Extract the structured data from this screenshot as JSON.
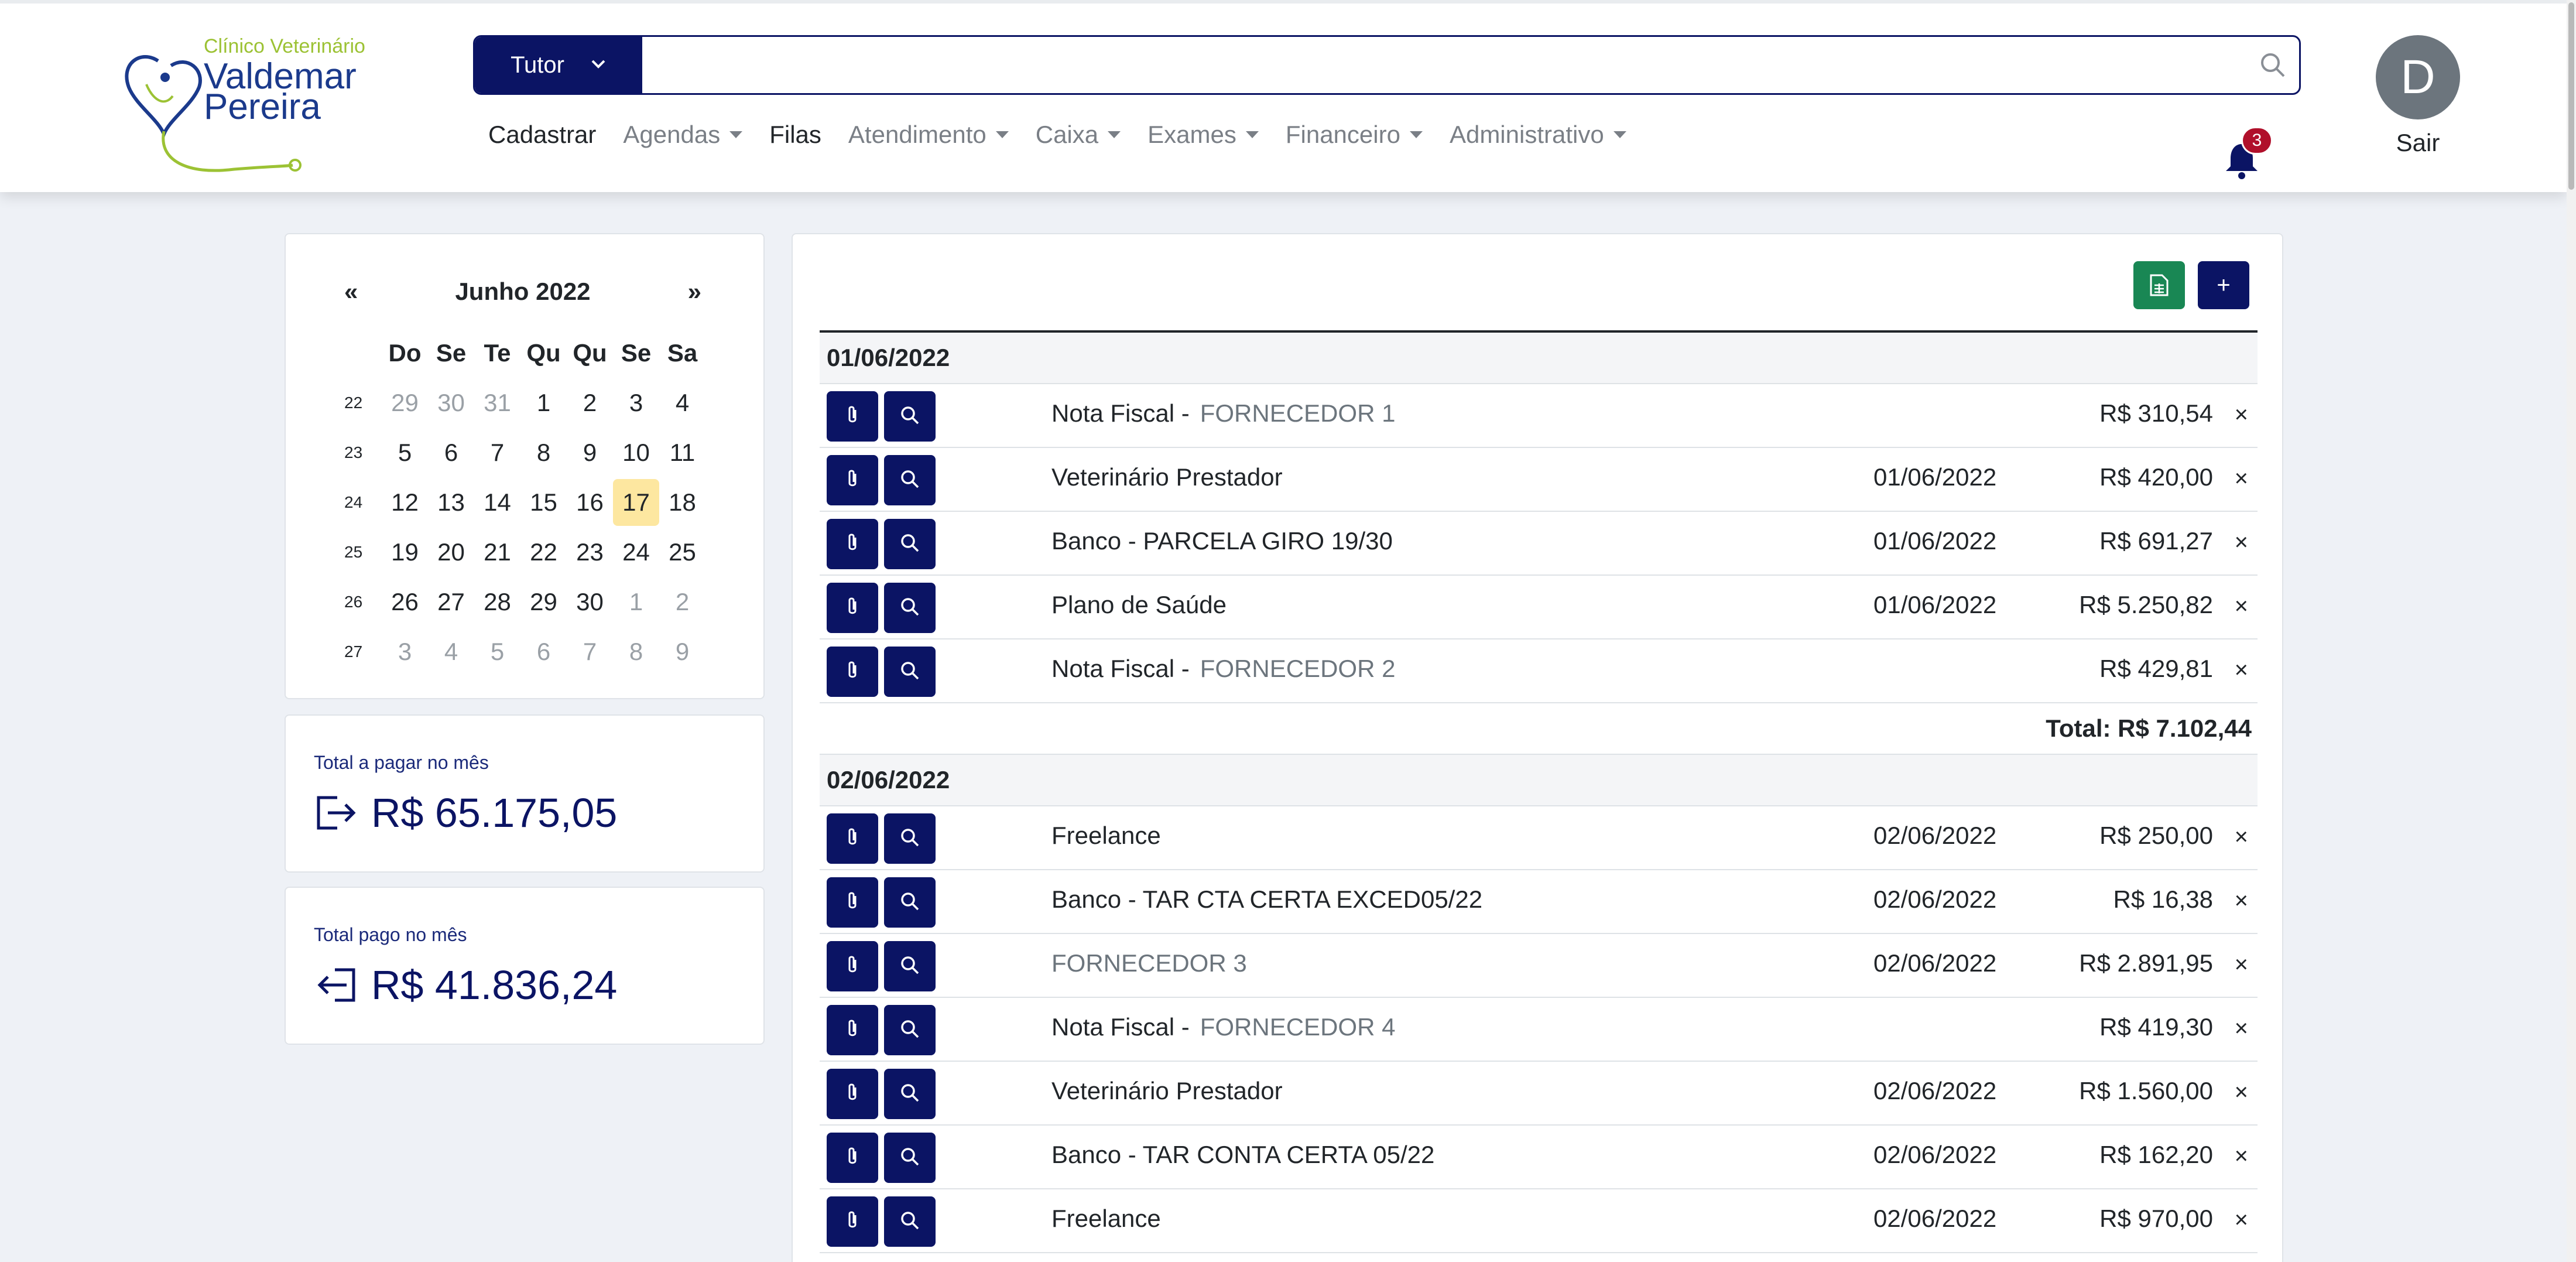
{
  "header": {
    "clinic_small": "Clínico Veterinário",
    "brand_line1": "Valdemar",
    "brand_line2": "Pereira",
    "search": {
      "selector_label": "Tutor",
      "value": "",
      "placeholder": ""
    },
    "nav": [
      {
        "label": "Cadastrar",
        "dropdown": false,
        "dark": true
      },
      {
        "label": "Agendas",
        "dropdown": true,
        "dark": false
      },
      {
        "label": "Filas",
        "dropdown": false,
        "dark": true
      },
      {
        "label": "Atendimento",
        "dropdown": true,
        "dark": false
      },
      {
        "label": "Caixa",
        "dropdown": true,
        "dark": false
      },
      {
        "label": "Exames",
        "dropdown": true,
        "dark": false
      },
      {
        "label": "Financeiro",
        "dropdown": true,
        "dark": false
      },
      {
        "label": "Administrativo",
        "dropdown": true,
        "dark": false
      }
    ],
    "notification_count": "3",
    "avatar_letter": "D",
    "logout_label": "Sair"
  },
  "calendar": {
    "prev": "«",
    "next": "»",
    "month_label": "Junho 2022",
    "weekdays": [
      "Do",
      "Se",
      "Te",
      "Qu",
      "Qu",
      "Se",
      "Sa"
    ],
    "weeks": [
      {
        "week": "22",
        "days": [
          [
            "29",
            true
          ],
          [
            "30",
            true
          ],
          [
            "31",
            true
          ],
          [
            "1",
            false
          ],
          [
            "2",
            false
          ],
          [
            "3",
            false
          ],
          [
            "4",
            false
          ]
        ]
      },
      {
        "week": "23",
        "days": [
          [
            "5",
            false
          ],
          [
            "6",
            false
          ],
          [
            "7",
            false
          ],
          [
            "8",
            false
          ],
          [
            "9",
            false
          ],
          [
            "10",
            false
          ],
          [
            "11",
            false
          ]
        ]
      },
      {
        "week": "24",
        "days": [
          [
            "12",
            false
          ],
          [
            "13",
            false
          ],
          [
            "14",
            false
          ],
          [
            "15",
            false
          ],
          [
            "16",
            false
          ],
          [
            "17",
            false
          ],
          [
            "18",
            false
          ]
        ]
      },
      {
        "week": "25",
        "days": [
          [
            "19",
            false
          ],
          [
            "20",
            false
          ],
          [
            "21",
            false
          ],
          [
            "22",
            false
          ],
          [
            "23",
            false
          ],
          [
            "24",
            false
          ],
          [
            "25",
            false
          ]
        ]
      },
      {
        "week": "26",
        "days": [
          [
            "26",
            false
          ],
          [
            "27",
            false
          ],
          [
            "28",
            false
          ],
          [
            "29",
            false
          ],
          [
            "30",
            false
          ],
          [
            "1",
            true
          ],
          [
            "2",
            true
          ]
        ]
      },
      {
        "week": "27",
        "days": [
          [
            "3",
            true
          ],
          [
            "4",
            true
          ],
          [
            "5",
            true
          ],
          [
            "6",
            true
          ],
          [
            "7",
            true
          ],
          [
            "8",
            true
          ],
          [
            "9",
            true
          ]
        ]
      }
    ],
    "selected_day": "17"
  },
  "totals": {
    "to_pay_label": "Total a pagar no mês",
    "to_pay_value": "R$ 65.175,05",
    "paid_label": "Total pago no mês",
    "paid_value": "R$ 41.836,24"
  },
  "colors": {
    "primary": "#0b1464",
    "excel": "#198754",
    "today": "#fde7a0",
    "badge": "#b0102b"
  },
  "ledger": {
    "add_label": "+",
    "delete_label": "×",
    "groups": [
      {
        "date": "01/06/2022",
        "total": "Total: R$ 7.102,44",
        "entries": [
          {
            "type": "Nota Fiscal -",
            "supplier": "FORNECEDOR 1",
            "date": "",
            "amount": "R$ 310,54"
          },
          {
            "type": "Veterinário Prestador",
            "supplier": "",
            "date": "01/06/2022",
            "amount": "R$ 420,00"
          },
          {
            "type": "Banco -  PARCELA GIRO 19/30",
            "supplier": "",
            "date": "01/06/2022",
            "amount": "R$ 691,27"
          },
          {
            "type": "Plano de Saúde",
            "supplier": "",
            "date": "01/06/2022",
            "amount": "R$ 5.250,82"
          },
          {
            "type": "Nota Fiscal -",
            "supplier": "FORNECEDOR 2",
            "date": "",
            "amount": "R$ 429,81"
          }
        ]
      },
      {
        "date": "02/06/2022",
        "total": "",
        "entries": [
          {
            "type": "Freelance",
            "supplier": "",
            "date": "02/06/2022",
            "amount": "R$ 250,00"
          },
          {
            "type": "Banco -  TAR CTA CERTA EXCED05/22",
            "supplier": "",
            "date": "02/06/2022",
            "amount": "R$ 16,38"
          },
          {
            "type": "",
            "supplier": "FORNECEDOR 3",
            "date": "02/06/2022",
            "amount": "R$ 2.891,95"
          },
          {
            "type": "Nota Fiscal -",
            "supplier": "FORNECEDOR 4",
            "date": "",
            "amount": "R$ 419,30"
          },
          {
            "type": "Veterinário Prestador",
            "supplier": "",
            "date": "02/06/2022",
            "amount": "R$ 1.560,00"
          },
          {
            "type": "Banco -  TAR CONTA CERTA 05/22",
            "supplier": "",
            "date": "02/06/2022",
            "amount": "R$ 162,20"
          },
          {
            "type": "Freelance",
            "supplier": "",
            "date": "02/06/2022",
            "amount": "R$ 970,00"
          }
        ]
      }
    ]
  }
}
